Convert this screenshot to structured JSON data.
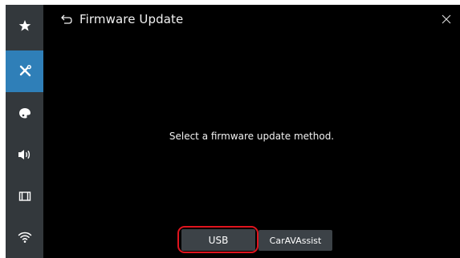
{
  "header": {
    "title": "Firmware Update",
    "back_icon": "back-arrow-icon",
    "close_icon": "close-icon"
  },
  "sidebar": {
    "items": [
      {
        "icon": "star-icon",
        "active": false
      },
      {
        "icon": "tools-icon",
        "active": true
      },
      {
        "icon": "palette-icon",
        "active": false
      },
      {
        "icon": "speaker-icon",
        "active": false
      },
      {
        "icon": "film-icon",
        "active": false
      },
      {
        "icon": "wifi-icon",
        "active": false
      }
    ]
  },
  "main": {
    "message": "Select a firmware update method."
  },
  "buttons": {
    "usb_label": "USB",
    "caravassist_label": "CarAVAssist"
  },
  "colors": {
    "background": "#000000",
    "sidebar": "#33383c",
    "active": "#2f7fb8",
    "button": "#3c4247",
    "highlight": "#e0141e"
  }
}
